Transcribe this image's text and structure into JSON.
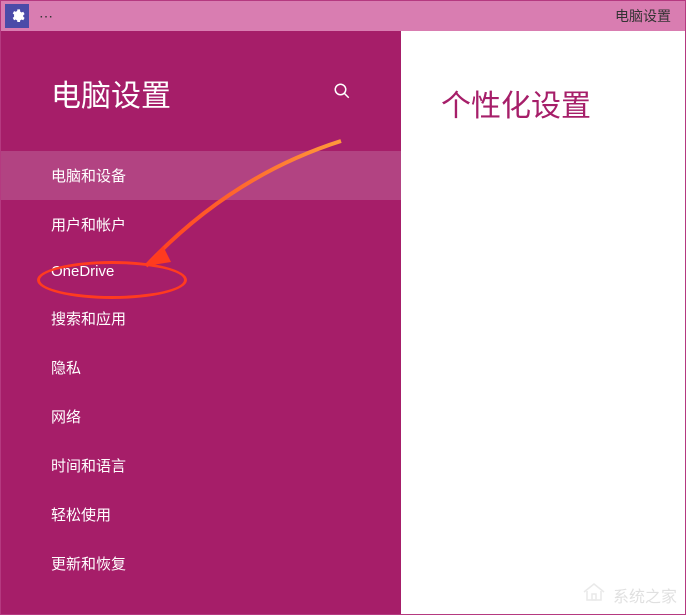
{
  "titlebar": {
    "dots": "⋯",
    "title": "电脑设置"
  },
  "sidebar": {
    "title": "电脑设置",
    "items": [
      {
        "label": "电脑和设备"
      },
      {
        "label": "用户和帐户"
      },
      {
        "label": "OneDrive"
      },
      {
        "label": "搜索和应用"
      },
      {
        "label": "隐私"
      },
      {
        "label": "网络"
      },
      {
        "label": "时间和语言"
      },
      {
        "label": "轻松使用"
      },
      {
        "label": "更新和恢复"
      }
    ]
  },
  "main": {
    "title": "个性化设置"
  },
  "watermark": {
    "text": "系统之家"
  },
  "annotation": {
    "highlight_item_index": 1
  }
}
